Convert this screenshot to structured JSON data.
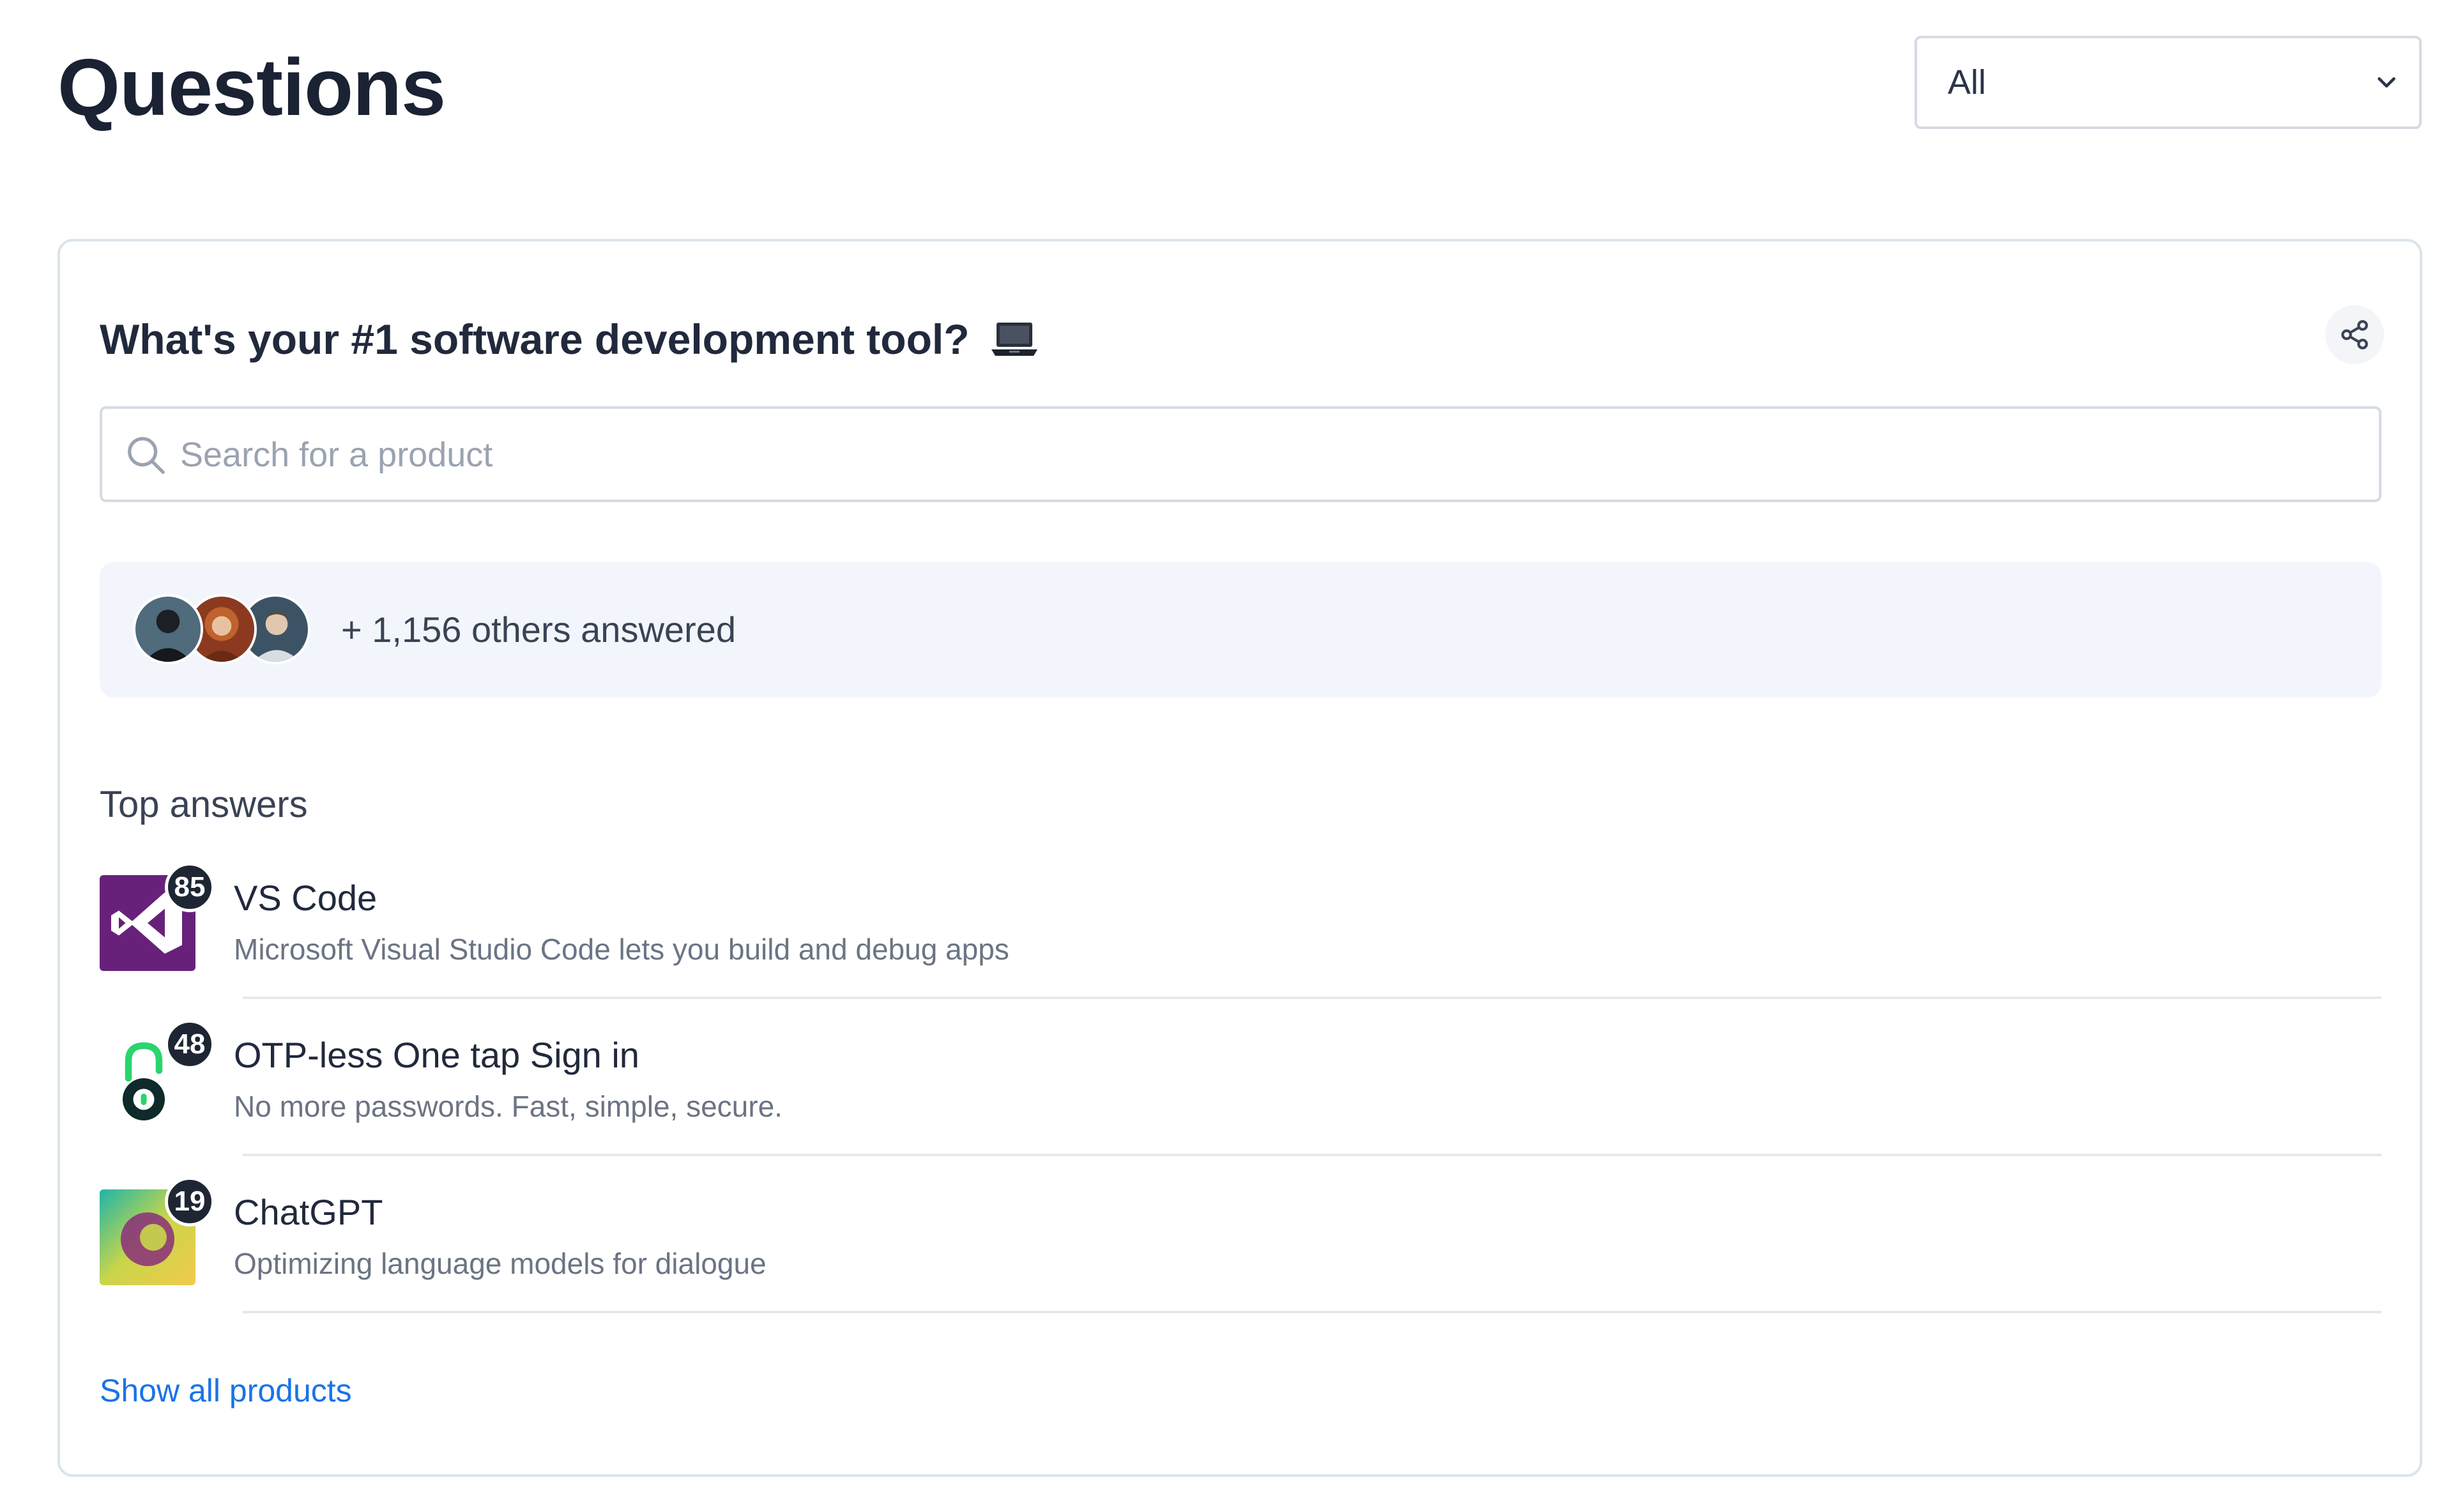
{
  "page": {
    "title": "Questions"
  },
  "filter": {
    "selected": "All"
  },
  "question": {
    "title": "What's your #1 software development tool?",
    "search_placeholder": "Search for a product",
    "answered_text": "+ 1,156 others answered",
    "top_answers_label": "Top answers",
    "answers": [
      {
        "name": "VS Code",
        "description": "Microsoft Visual Studio Code lets you build and debug apps",
        "count": "85",
        "icon": "vscode-logo-icon"
      },
      {
        "name": "OTP-less One tap Sign in",
        "description": "No more passwords. Fast, simple, secure.",
        "count": "48",
        "icon": "padlock-logo-icon"
      },
      {
        "name": "ChatGPT",
        "description": "Optimizing language models for dialogue",
        "count": "19",
        "icon": "chatgpt-logo-icon"
      }
    ],
    "show_all_label": "Show all products"
  },
  "colors": {
    "accent_link": "#1a73e8",
    "vscode_purple": "#68217a",
    "badge_bg": "#1f2633",
    "answered_bg": "#f2f6fc"
  }
}
